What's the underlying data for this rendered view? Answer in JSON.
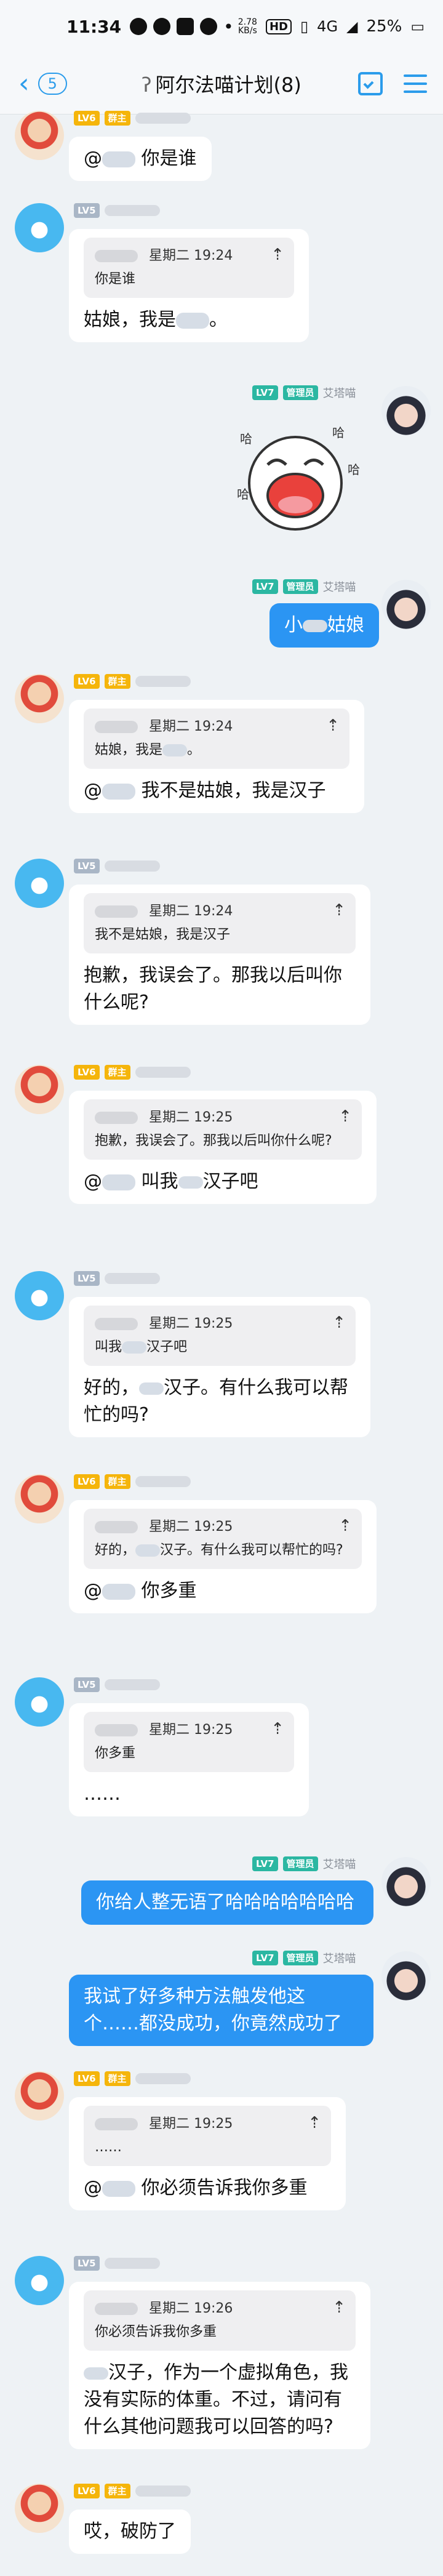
{
  "status": {
    "time": "11:34",
    "hd": "HD",
    "network": "4G",
    "speed_top": "2.78",
    "speed_unit": "KB/s",
    "battery": "25%"
  },
  "nav": {
    "back_count": "5",
    "title": "阿尔法喵计划(8)"
  },
  "roles": {
    "lv6": "LV6",
    "lv5": "LV5",
    "lv7": "LV7",
    "owner": "群主",
    "admin": "管理员",
    "admin_name": "艾塔喵"
  },
  "messages": [
    {
      "text": "@ 你是谁",
      "at": "@",
      "body": "你是谁"
    },
    {
      "q_time": "星期二 19:24",
      "q_text": "你是谁",
      "a": "姑娘，我是",
      "a2": "。"
    },
    {
      "sticker": "sticker"
    },
    {
      "text_a": "小",
      "text_b": "姑娘"
    },
    {
      "q_time": "星期二 19:24",
      "q_text_a": "姑娘，我是",
      "q_text_b": "。",
      "body": "@",
      "body2": "我不是姑娘，我是汉子"
    },
    {
      "q_time": "星期二 19:24",
      "q_text": "我不是姑娘，我是汉子",
      "body": "抱歉，我误会了。那我以后叫你什么呢?"
    },
    {
      "q_time": "星期二 19:25",
      "q_text": "抱歉，我误会了。那我以后叫你什么呢?",
      "body": "@",
      "body2": "叫我",
      "body3": "汉子吧"
    },
    {
      "q_time": "星期二 19:25",
      "q_text_a": "叫我",
      "q_text_b": "汉子吧",
      "body_a": "好的，",
      "body_b": "汉子。有什么我可以帮忙的吗?"
    },
    {
      "q_time": "星期二 19:25",
      "q_text_a": "好的，",
      "q_text_b": "汉子。有什么我可以帮忙的吗?",
      "body": "@",
      "body2": "你多重"
    },
    {
      "q_time": "星期二 19:25",
      "q_text": "你多重",
      "body": "……"
    },
    {
      "body": "你给人整无语了哈哈哈哈哈哈哈"
    },
    {
      "body": "我试了好多种方法触发他这个……都没成功，你竟然成功了"
    },
    {
      "q_time": "星期二 19:25",
      "q_text": "……",
      "body": "@",
      "body2": "你必须告诉我你多重"
    },
    {
      "q_time": "星期二 19:26",
      "q_text": "你必须告诉我你多重",
      "body_a": "汉子，作为一个虚拟角色，我没有实际的体重。不过，请问有什么其他问题我可以回答的吗?"
    },
    {
      "body": "哎，破防了"
    }
  ]
}
